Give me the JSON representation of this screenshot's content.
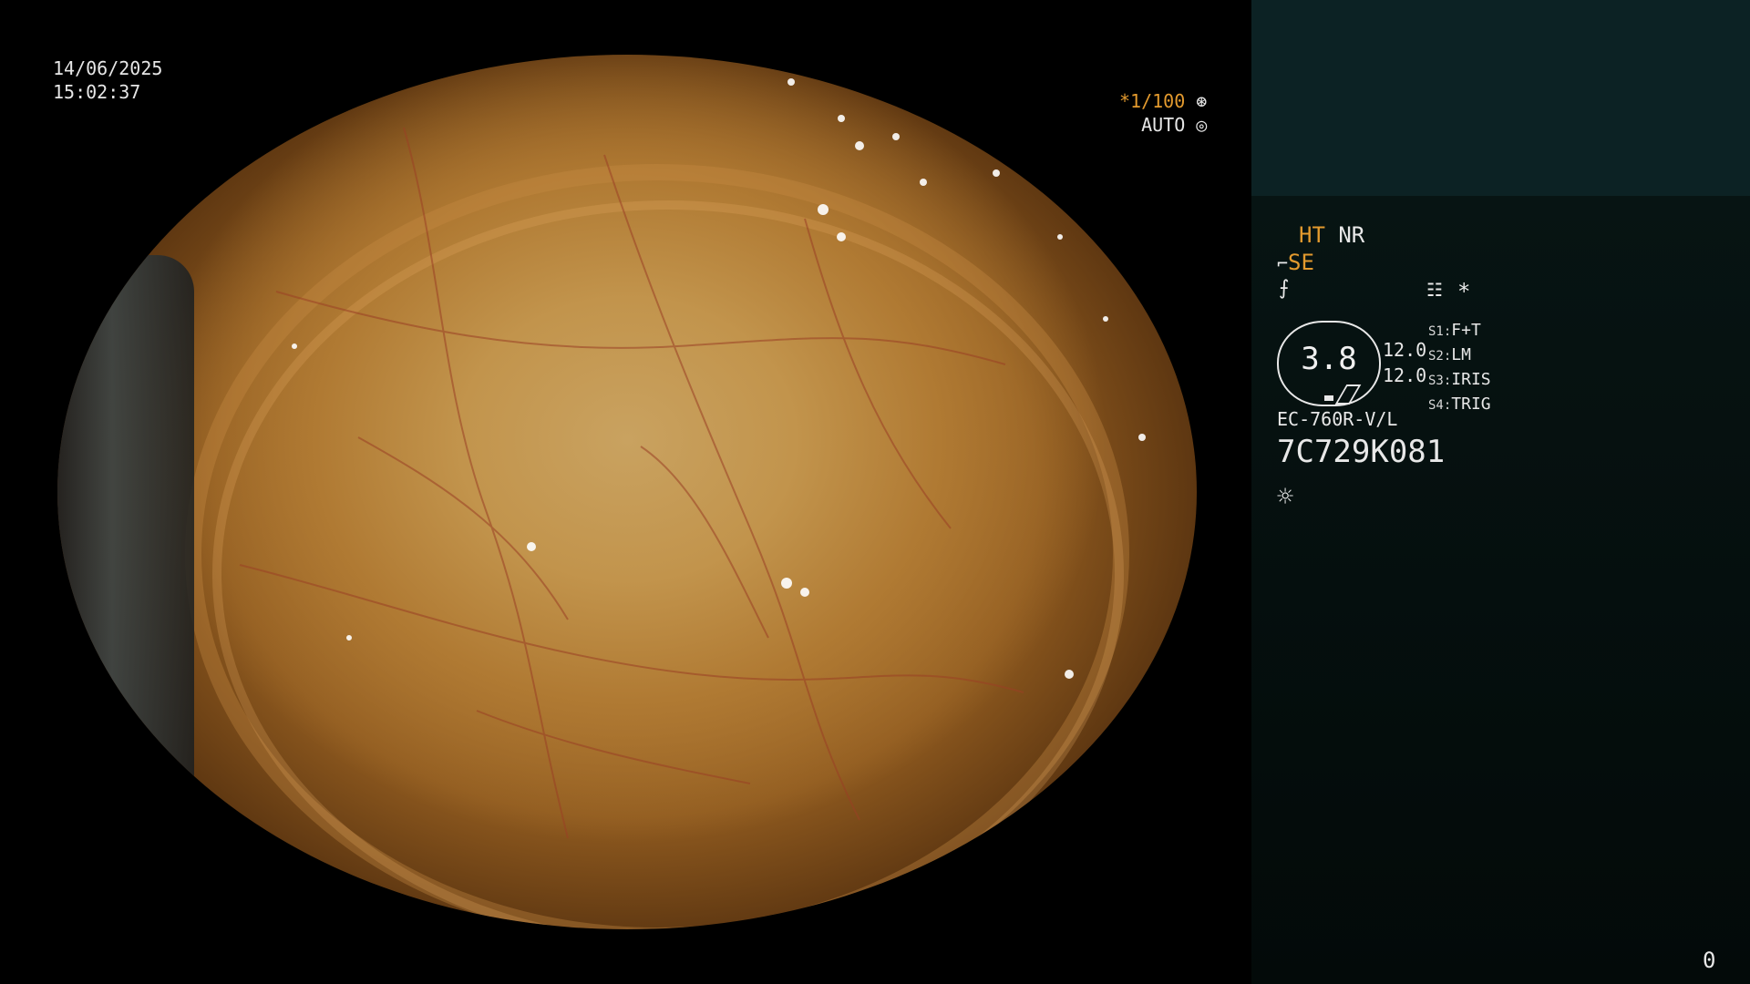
{
  "video": {
    "date": "14/06/2025",
    "time": "15:02:37",
    "shutter_value": "*1/100",
    "exposure_mode": "AUTO",
    "shutter_icon": "aperture-icon",
    "exposure_icon": "ring-icon"
  },
  "panel": {
    "ht_label": "HT",
    "nr_label": "NR",
    "se_label": "SE",
    "brightness_label": "3.8",
    "value_1": "12.0",
    "value_2": "12.0",
    "buttons": [
      {
        "key": "S1:",
        "value": "F+T"
      },
      {
        "key": "S2:",
        "value": "LM"
      },
      {
        "key": "S3:",
        "value": "IRIS"
      },
      {
        "key": "S4:",
        "value": "TRIG"
      }
    ],
    "model": "EC-760R-V/L",
    "serial": "7C729K081",
    "asterisk": "*",
    "frame_count": "0"
  },
  "colors": {
    "accent_orange": "#e39a2e",
    "panel_bg": "#071413",
    "panel_top": "#0c2224"
  }
}
